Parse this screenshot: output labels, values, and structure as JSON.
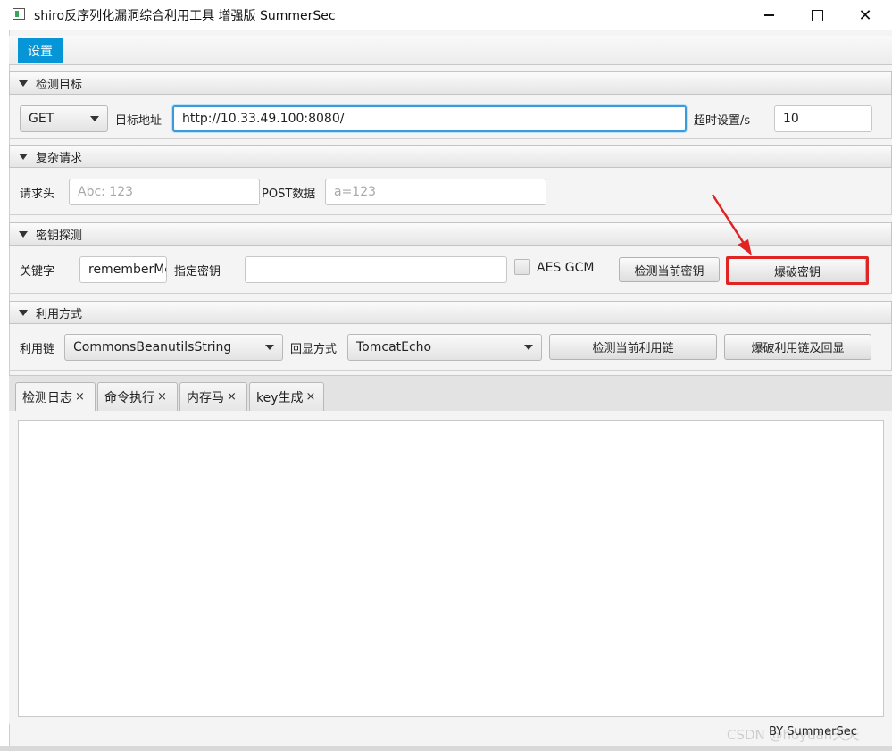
{
  "window": {
    "title": "shiro反序列化漏洞综合利用工具 增强版 SummerSec",
    "minimize_icon": "minimize-icon",
    "maximize_icon": "maximize-icon",
    "close_glyph": "✕"
  },
  "menu": {
    "settings_label": "设置"
  },
  "detect_target": {
    "header": "检测目标",
    "method_value": "GET",
    "target_label": "目标地址",
    "target_value": "http://10.33.49.100:8080/",
    "timeout_label": "超时设置/s",
    "timeout_value": "10"
  },
  "complex_request": {
    "header": "复杂请求",
    "headers_label": "请求头",
    "headers_placeholder": "Abc: 123",
    "post_label": "POST数据",
    "post_placeholder": "a=123"
  },
  "key_probe": {
    "header": "密钥探测",
    "keyword_label": "关键字",
    "keyword_value": "rememberMe",
    "specify_key_label": "指定密钥",
    "specify_key_value": "",
    "aes_gcm_label": "AES GCM",
    "detect_key_button": "检测当前密钥",
    "brute_key_button": "爆破密钥"
  },
  "exploit": {
    "header": "利用方式",
    "chain_label": "利用链",
    "chain_value": "CommonsBeanutilsString",
    "echo_label": "回显方式",
    "echo_value": "TomcatEcho",
    "detect_chain_button": "检测当前利用链",
    "brute_chain_button": "爆破利用链及回显"
  },
  "tabs": [
    {
      "label": "检测日志",
      "close": "×"
    },
    {
      "label": "命令执行",
      "close": "×"
    },
    {
      "label": "内存马",
      "close": "×"
    },
    {
      "label": "key生成",
      "close": "×"
    }
  ],
  "footer": {
    "credit": "BY  SummerSec"
  },
  "watermark": "CSDN @hoyuan天天",
  "colors": {
    "accent": "#0696d7",
    "highlight": "#e02424",
    "focus": "#3a9bdc"
  }
}
